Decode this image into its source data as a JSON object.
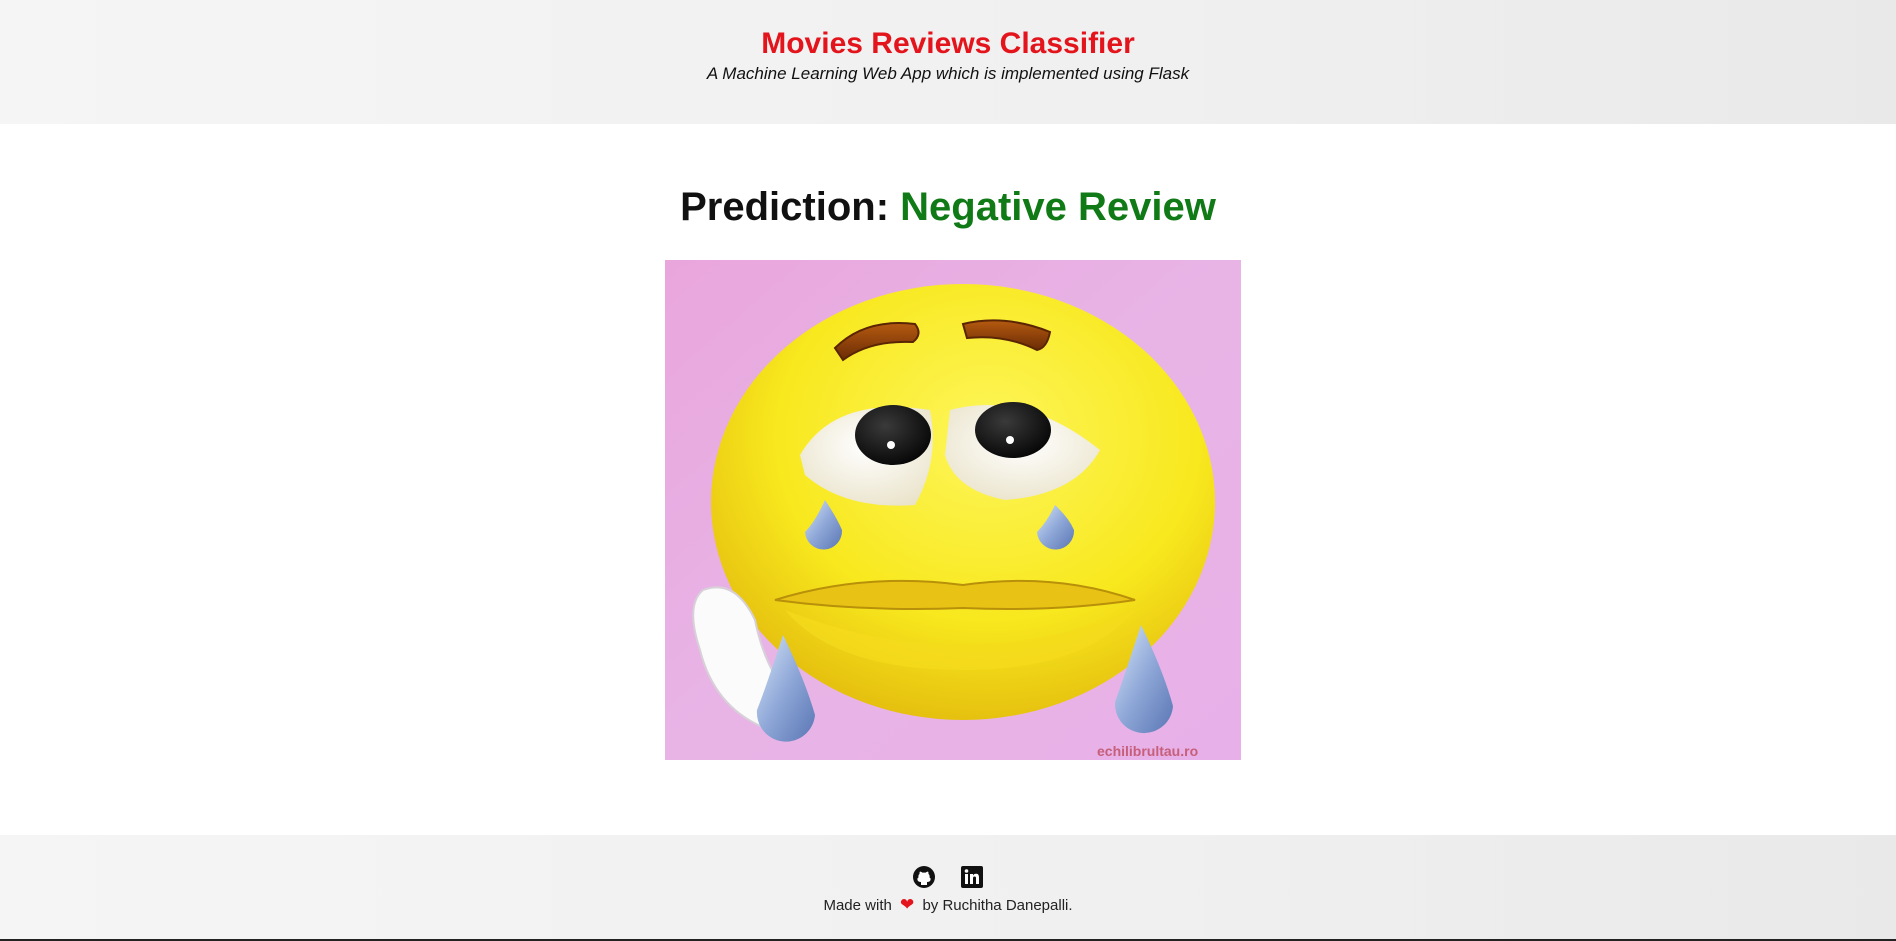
{
  "header": {
    "title": "Movies Reviews Classifier",
    "subtitle": "A Machine Learning Web App which is implemented using Flask"
  },
  "result": {
    "label": "Prediction:",
    "value": "Negative Review",
    "image_watermark": "echilibrultau.ro"
  },
  "footer": {
    "icons": [
      "github-icon",
      "linkedin-icon"
    ],
    "made_with": "Made with",
    "heart": "❤",
    "by": "by Ruchitha Danepalli."
  },
  "colors": {
    "title": "#e3141b",
    "prediction_value": "#107a16",
    "header_bg": "#f0f0f0",
    "heart": "#e3141b"
  }
}
